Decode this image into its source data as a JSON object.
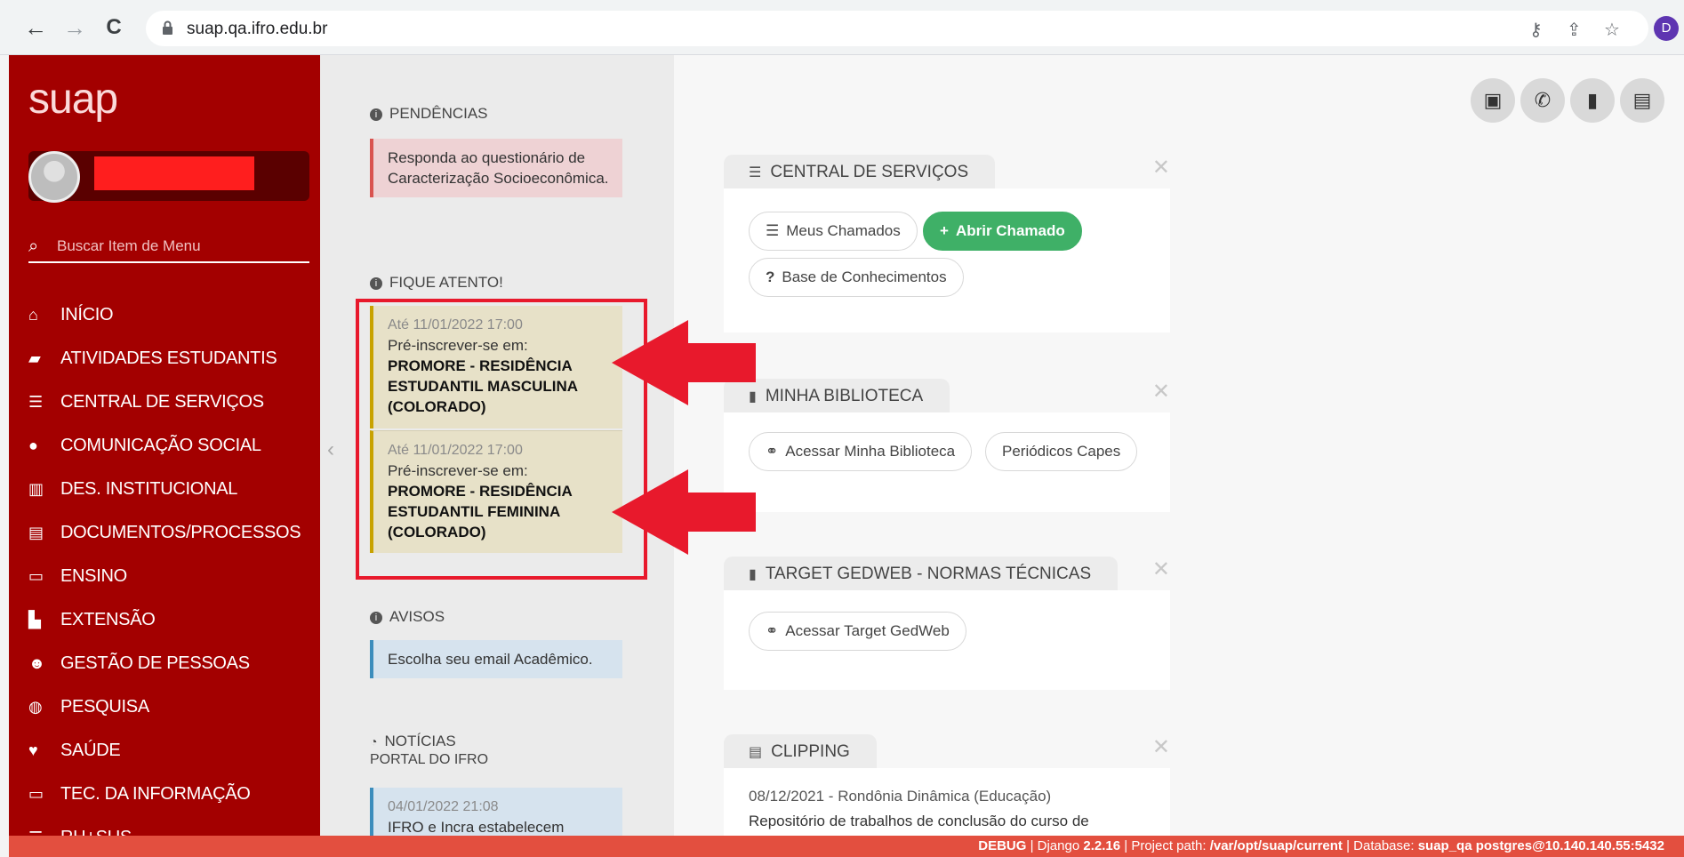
{
  "browser": {
    "url": "suap.qa.ifro.edu.br",
    "profile_initial": "D"
  },
  "sidebar": {
    "logo": "suap",
    "search_placeholder": "Buscar Item de Menu",
    "items": [
      {
        "label": "INÍCIO",
        "icon": "home-icon"
      },
      {
        "label": "ATIVIDADES ESTUDANTIS",
        "icon": "graduation-cap-icon"
      },
      {
        "label": "CENTRAL DE SERVIÇOS",
        "icon": "list-icon"
      },
      {
        "label": "COMUNICAÇÃO SOCIAL",
        "icon": "speech-bubble-icon"
      },
      {
        "label": "DES. INSTITUCIONAL",
        "icon": "bar-chart-icon"
      },
      {
        "label": "DOCUMENTOS/PROCESSOS",
        "icon": "document-edit-icon"
      },
      {
        "label": "ENSINO",
        "icon": "teacher-board-icon"
      },
      {
        "label": "EXTENSÃO",
        "icon": "building-icon"
      },
      {
        "label": "GESTÃO DE PESSOAS",
        "icon": "users-icon"
      },
      {
        "label": "PESQUISA",
        "icon": "globe-icon"
      },
      {
        "label": "SAÚDE",
        "icon": "heart-icon"
      },
      {
        "label": "TEC. DA INFORMAÇÃO",
        "icon": "laptop-icon"
      },
      {
        "label": "RH+SUS",
        "icon": "menu-icon"
      }
    ]
  },
  "pendencias": {
    "heading": "PENDÊNCIAS",
    "card_text": "Responda ao questionário de Caracterização Socioeconômica."
  },
  "fique_atento": {
    "heading": "FIQUE ATENTO!",
    "cards": [
      {
        "date": "Até 11/01/2022 17:00",
        "text": "Pré-inscrever-se em:",
        "strong": "PROMORE - RESIDÊNCIA ESTUDANTIL MASCULINA (COLORADO)"
      },
      {
        "date": "Até 11/01/2022 17:00",
        "text": "Pré-inscrever-se em:",
        "strong": "PROMORE - RESIDÊNCIA ESTUDANTIL FEMININA (COLORADO)"
      }
    ]
  },
  "avisos": {
    "heading": "AVISOS",
    "card_text": "Escolha seu email Acadêmico."
  },
  "noticias": {
    "heading": "NOTÍCIAS",
    "subheading": "PORTAL DO IFRO",
    "date": "04/01/2022 21:08",
    "text": "IFRO e Incra estabelecem"
  },
  "widgets": {
    "central": {
      "title": "CENTRAL DE SERVIÇOS",
      "meus_chamados": "Meus Chamados",
      "abrir_chamado": "Abrir Chamado",
      "base_conhecimentos": "Base de Conhecimentos"
    },
    "biblioteca": {
      "title": "MINHA BIBLIOTECA",
      "acessar": "Acessar Minha Biblioteca",
      "periodicos": "Periódicos Capes"
    },
    "target": {
      "title": "TARGET GEDWEB - NORMAS TÉCNICAS",
      "acessar": "Acessar Target GedWeb"
    },
    "clipping": {
      "title": "CLIPPING",
      "line1": "08/12/2021 - Rondônia Dinâmica (Educação)",
      "line2": "Repositório de trabalhos de conclusão do curso de"
    }
  },
  "debug": {
    "label": "DEBUG",
    "django_prefix": "Django",
    "django_version": "2.2.16",
    "path_prefix": "Project path:",
    "path": "/var/opt/suap/current",
    "db_prefix": "Database:",
    "db": "suap_qa postgres@10.140.140.55:5432"
  },
  "colors": {
    "sidebar": "#a30000",
    "accent_green": "#3fb067",
    "highlight_red": "#e8192c",
    "debug_bar": "#e34f3f"
  }
}
